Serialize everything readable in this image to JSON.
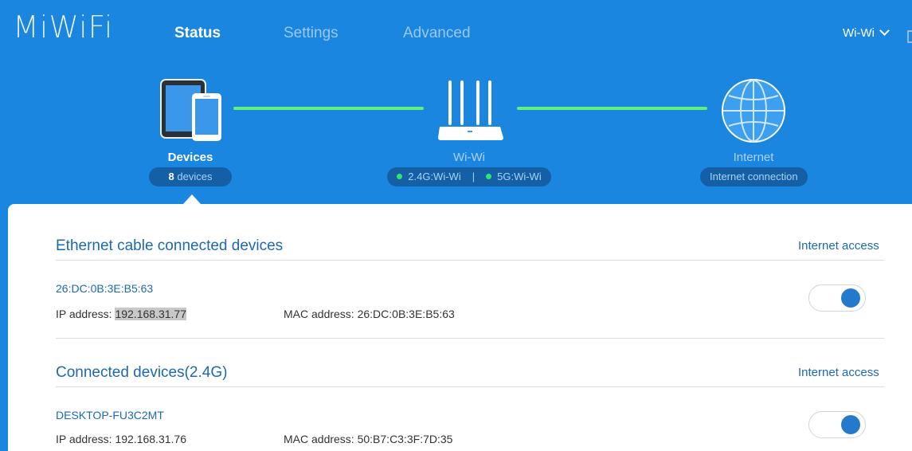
{
  "header": {
    "logo": "MiWiFi",
    "nav": [
      "Status",
      "Settings",
      "Advanced"
    ],
    "active_nav": "Status",
    "user_menu": "Wi-Wi"
  },
  "topology": {
    "devices": {
      "label": "Devices",
      "count_num": "8",
      "count_unit": "devices"
    },
    "router": {
      "label": "Wi-Wi",
      "band_24": "2.4G:Wi-Wi",
      "band_5": "5G:Wi-Wi",
      "separator": "|"
    },
    "internet": {
      "label": "Internet",
      "status": "Internet connection"
    }
  },
  "sections": [
    {
      "title": "Ethernet cable connected devices",
      "access_label": "Internet access",
      "devices": [
        {
          "name": "26:DC:0B:3E:B5:63",
          "ip_label": "IP address:",
          "ip": "192.168.31.77",
          "mac_label": "MAC address:",
          "mac": "26:DC:0B:3E:B5:63",
          "internet_access": true
        }
      ]
    },
    {
      "title": "Connected devices(2.4G)",
      "access_label": "Internet access",
      "devices": [
        {
          "name": "DESKTOP-FU3C2MT",
          "ip_label": "IP address:",
          "ip": "192.168.31.76",
          "mac_label": "MAC address:",
          "mac": "50:B7:C3:3F:7D:35",
          "internet_access": true
        }
      ]
    }
  ],
  "colors": {
    "header_bg": "#1a86e0",
    "link_line": "#62ef7e",
    "accent_text": "#1d68b2",
    "toggle_on": "#2379cc"
  }
}
